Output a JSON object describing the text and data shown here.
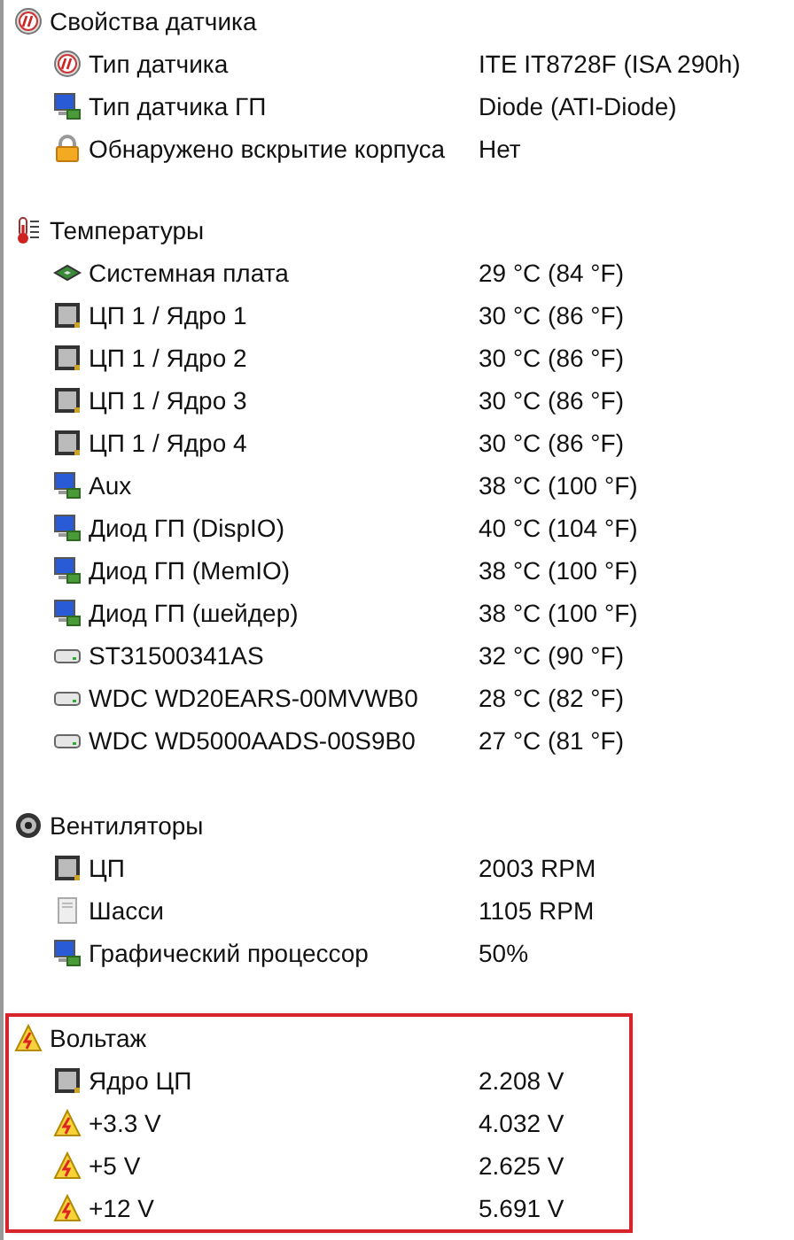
{
  "groups": [
    {
      "title": "Свойства датчика",
      "kind": "gauge",
      "highlighted": false,
      "items": [
        {
          "kind": "gauge",
          "label": "Тип датчика",
          "value": "ITE IT8728F  (ISA 290h)"
        },
        {
          "kind": "gpu",
          "label": "Тип датчика ГП",
          "value": "Diode  (ATI-Diode)"
        },
        {
          "kind": "lock",
          "label": "Обнаружено вскрытие корпуса",
          "value": "Нет"
        }
      ]
    },
    {
      "title": "Температуры",
      "kind": "thermometer",
      "highlighted": false,
      "items": [
        {
          "kind": "board",
          "label": "Системная плата",
          "value": "29 °C  (84 °F)"
        },
        {
          "kind": "cpu",
          "label": "ЦП 1 / Ядро 1",
          "value": "30 °C  (86 °F)"
        },
        {
          "kind": "cpu",
          "label": "ЦП 1 / Ядро 2",
          "value": "30 °C  (86 °F)"
        },
        {
          "kind": "cpu",
          "label": "ЦП 1 / Ядро 3",
          "value": "30 °C  (86 °F)"
        },
        {
          "kind": "cpu",
          "label": "ЦП 1 / Ядро 4",
          "value": "30 °C  (86 °F)"
        },
        {
          "kind": "aux",
          "label": "Aux",
          "value": "38 °C  (100 °F)"
        },
        {
          "kind": "gpu",
          "label": "Диод ГП (DispIO)",
          "value": "40 °C  (104 °F)"
        },
        {
          "kind": "gpu",
          "label": "Диод ГП (MemIO)",
          "value": "38 °C  (100 °F)"
        },
        {
          "kind": "gpu",
          "label": "Диод ГП (шейдер)",
          "value": "38 °C  (100 °F)"
        },
        {
          "kind": "hdd",
          "label": "ST31500341AS",
          "value": "32 °C  (90 °F)"
        },
        {
          "kind": "hdd",
          "label": "WDC WD20EARS-00MVWB0",
          "value": "28 °C  (82 °F)"
        },
        {
          "kind": "hdd",
          "label": "WDC WD5000AADS-00S9B0",
          "value": "27 °C  (81 °F)"
        }
      ]
    },
    {
      "title": "Вентиляторы",
      "kind": "fan",
      "highlighted": false,
      "items": [
        {
          "kind": "cpu",
          "label": "ЦП",
          "value": "2003 RPM"
        },
        {
          "kind": "chassis",
          "label": "Шасси",
          "value": "1105 RPM"
        },
        {
          "kind": "gpu",
          "label": "Графический процессор",
          "value": "50%"
        }
      ]
    },
    {
      "title": "Вольтаж",
      "kind": "voltage",
      "highlighted": true,
      "items": [
        {
          "kind": "cpu",
          "label": "Ядро ЦП",
          "value": "2.208 V"
        },
        {
          "kind": "voltage",
          "label": "+3.3 V",
          "value": "4.032 V"
        },
        {
          "kind": "voltage",
          "label": "+5 V",
          "value": "2.625 V"
        },
        {
          "kind": "voltage",
          "label": "+12 V",
          "value": "5.691 V"
        }
      ]
    }
  ]
}
